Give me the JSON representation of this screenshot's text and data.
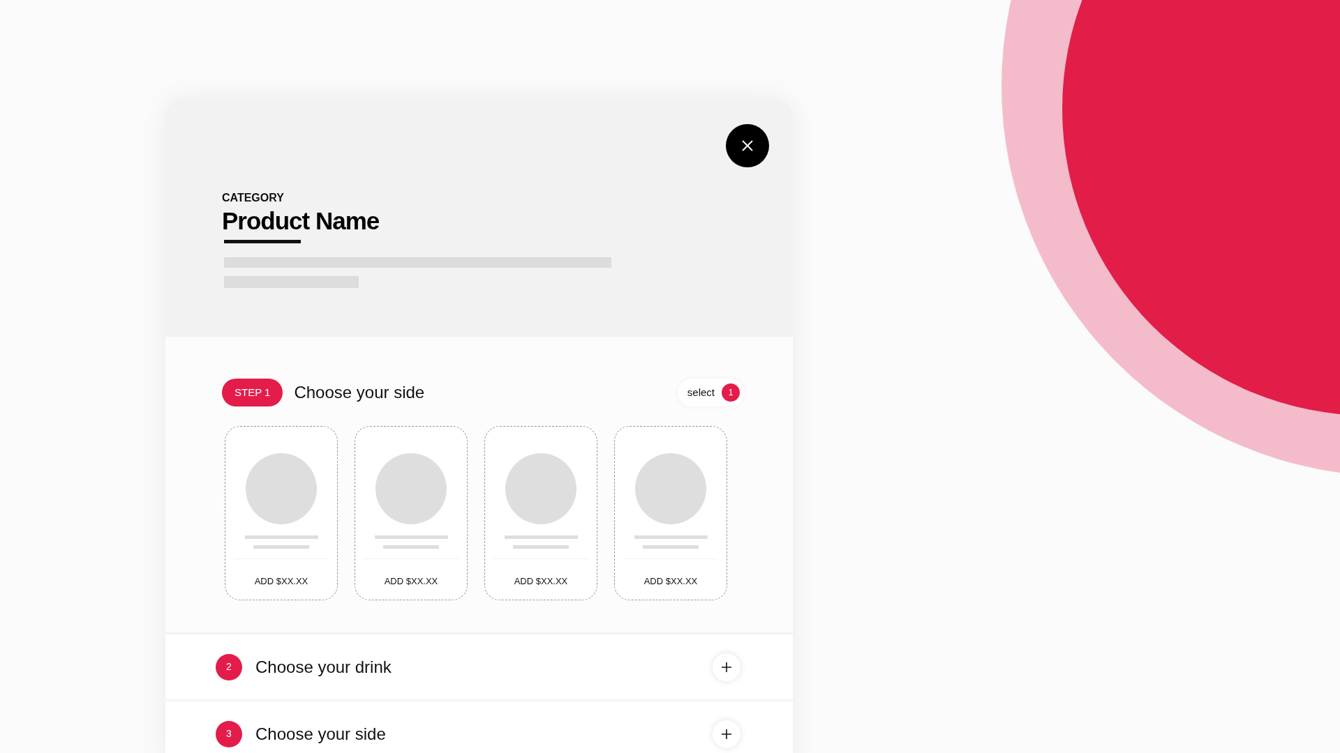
{
  "header": {
    "category": "CATEGORY",
    "title": "Product Name"
  },
  "steps": [
    {
      "badge": "STEP 1",
      "title": "Choose your side",
      "expanded": true,
      "select_label": "select",
      "select_count": "1",
      "options": [
        {
          "price": "ADD $XX.XX"
        },
        {
          "price": "ADD $XX.XX"
        },
        {
          "price": "ADD $XX.XX"
        },
        {
          "price": "ADD $XX.XX"
        }
      ]
    },
    {
      "badge": "2",
      "title": "Choose your drink",
      "expanded": false
    },
    {
      "badge": "3",
      "title": "Choose your side",
      "expanded": false
    }
  ]
}
